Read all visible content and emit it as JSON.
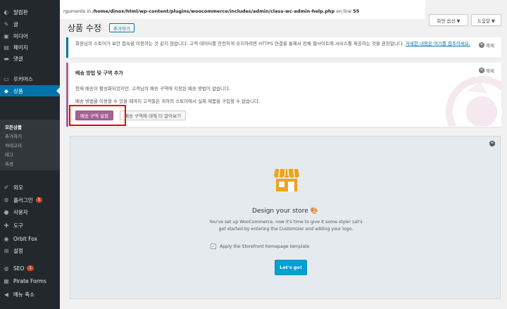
{
  "sidebar": {
    "items": [
      {
        "label": "알림판",
        "icon": "dashboard-icon",
        "glyph": "◐"
      },
      {
        "label": "글",
        "icon": "pin-icon",
        "glyph": "✎"
      },
      {
        "label": "미디어",
        "icon": "media-icon",
        "glyph": "▣"
      },
      {
        "label": "페이지",
        "icon": "page-icon",
        "glyph": "▤"
      },
      {
        "label": "댓글",
        "icon": "comment-icon",
        "glyph": "▬"
      },
      {
        "label": "우커머스",
        "icon": "woocommerce-icon",
        "glyph": "▭"
      },
      {
        "label": "상품",
        "icon": "products-icon",
        "glyph": "◆"
      }
    ],
    "submenu": [
      "모든상품",
      "추가하기",
      "카테고리",
      "태그",
      "속성"
    ],
    "items2": [
      {
        "label": "외모",
        "icon": "appearance-icon",
        "glyph": "✐"
      },
      {
        "label": "플러그인",
        "icon": "plugins-icon",
        "glyph": "⚙",
        "badge": "1"
      },
      {
        "label": "사용자",
        "icon": "users-icon",
        "glyph": "●"
      },
      {
        "label": "도구",
        "icon": "tools-icon",
        "glyph": "✚"
      },
      {
        "label": "Orbit Fox",
        "icon": "orbitfox-icon",
        "glyph": "◉"
      },
      {
        "label": "설정",
        "icon": "settings-icon",
        "glyph": "⊞"
      },
      {
        "label": "SEO",
        "icon": "seo-icon",
        "glyph": "◍",
        "badge": "1"
      },
      {
        "label": "Pirate Forms",
        "icon": "pirate-forms-icon",
        "glyph": "▦"
      },
      {
        "label": "메뉴 축소",
        "icon": "collapse-icon",
        "glyph": "◀"
      }
    ]
  },
  "header": {
    "notice_prefix": "rguments in ",
    "notice_path": "/home/dinox/html/wp-content/plugins/woocommerce/includes/admin/class-wc-admin-help.php",
    "notice_suffix": " on line ",
    "notice_line": "55",
    "screen_options": "화면 옵션 ▼",
    "help": "도움말 ▼"
  },
  "page": {
    "title": "상품 수정",
    "add_new": "추가하기"
  },
  "notice_https": {
    "text": "회원님의 스토어가 보안 접속을 이용하는 것 같지 않습니다. 고객 데이터를 안전하게 유지하려면 HTTPS 연결을 통해서 전체 웹사이트에 서비스를 제공하는 것을 권장합니다. ",
    "link": "자세한 내용은 여기를 참조하세요.",
    "dismiss": "해제"
  },
  "notice_shipping": {
    "title": "배송 방법 및 구역 추가",
    "p1": "현재 배송이 활성화되었지만, 고객님의 배송 구역에 지정된 배송 방법이 없습니다.",
    "p2": "배송 방법을 이용할 수 있을 때까지 고객들은 귀하의 스토어에서 실제 제품을 구입할 수 없습니다.",
    "primary_button": "배송 구역 설정",
    "secondary_button": "배송 구역에 대해 더 알아보기",
    "dismiss": "해제"
  },
  "onboarding": {
    "title": "Design your store",
    "emoji": "🎨",
    "description": "You've set up WooCommerce, now it's time to give it some style! Let's get started by entering the Customizer and adding your logo.",
    "checkbox_label": "Apply the Storefront homepage template",
    "checkbox_checked": "✓",
    "button": "Let's go!",
    "close": "✕"
  },
  "colors": {
    "sidebar_bg": "#23282d",
    "sidebar_active": "#0073aa",
    "woo_purple": "#a46497",
    "go_blue": "#00a0d2",
    "store_orange": "#f0a21b",
    "highlight_red": "#ee0000"
  }
}
